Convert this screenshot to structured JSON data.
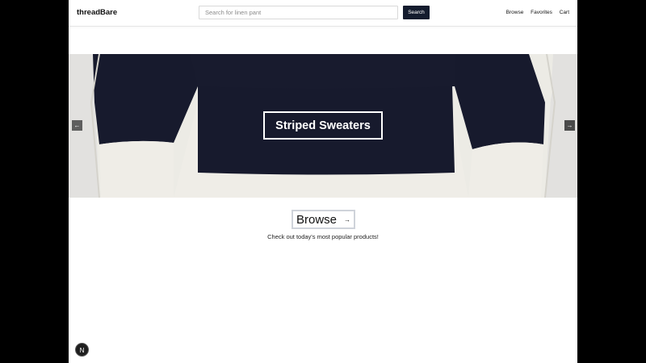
{
  "header": {
    "brand": "threadBare",
    "search_placeholder": "Search for linen pant",
    "search_button": "Search",
    "nav": [
      "Browse",
      "Favorites",
      "Cart"
    ]
  },
  "hero": {
    "title": "Striped Sweaters",
    "prev_icon": "arrow-left-icon",
    "next_icon": "arrow-right-icon"
  },
  "cta": {
    "label": "Browse",
    "arrow": "→",
    "tagline": "Check out today's most popular products!"
  },
  "dev_badge": "N",
  "colors": {
    "navy": "#141c2e",
    "sweater_cream": "#efede7",
    "sweater_navy": "#171a2d"
  }
}
